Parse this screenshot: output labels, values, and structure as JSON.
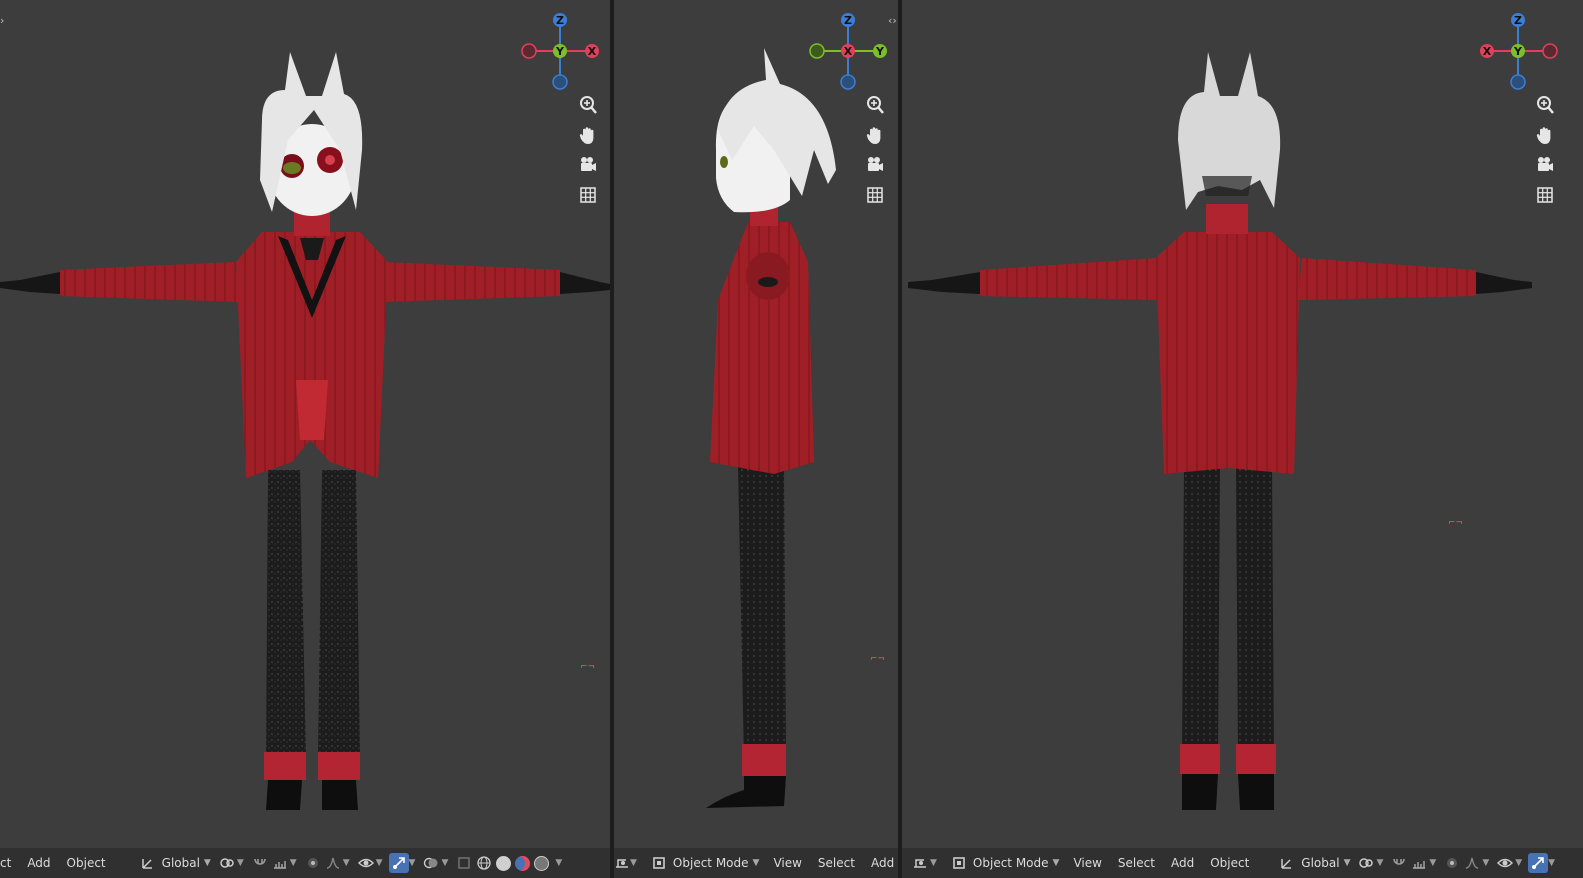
{
  "viewports": [
    {
      "id": "front",
      "gizmo": {
        "top": "Z",
        "center": "Y",
        "right": "X"
      },
      "header": {
        "items": [
          "ct",
          "Add",
          "Object"
        ],
        "orientation": "Global"
      }
    },
    {
      "id": "side",
      "gizmo": {
        "top": "Z",
        "center": "X",
        "right": "Y"
      },
      "header": {
        "mode": "Object Mode",
        "items": [
          "View",
          "Select",
          "Add"
        ]
      }
    },
    {
      "id": "back",
      "gizmo": {
        "top": "Z",
        "center": "Y",
        "left": "X"
      },
      "header": {
        "mode": "Object Mode",
        "items": [
          "View",
          "Select",
          "Add",
          "Object"
        ],
        "orientation": "Global"
      }
    }
  ],
  "split_arrow": "‹›",
  "colors": {
    "viewport_bg": "#3d3d3d",
    "header_bg": "#303030",
    "axis_x": "#e0405a",
    "axis_y": "#7cbf2a",
    "axis_z": "#3b7ed6",
    "active_icon": "#4772b3",
    "coat_red": "#9e1c24",
    "pants_black": "#1b1b1b",
    "hair_white": "#e6e6e6"
  },
  "icons": [
    "zoom-icon",
    "hand-pan-icon",
    "camera-icon",
    "grid-icon"
  ]
}
